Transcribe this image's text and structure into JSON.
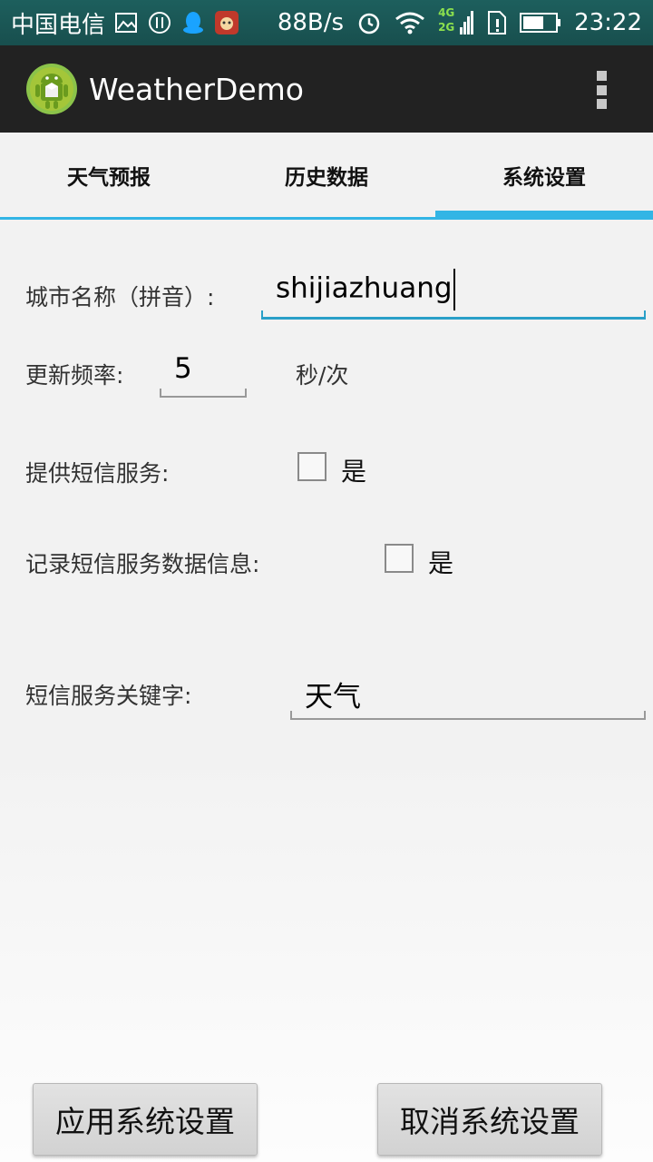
{
  "status_bar": {
    "carrier": "中国电信",
    "net_speed": "88B/s",
    "network_top": "4G",
    "network_bottom": "2G",
    "time": "23:22"
  },
  "action_bar": {
    "title": "WeatherDemo"
  },
  "tabs": [
    {
      "label": "天气预报",
      "active": false
    },
    {
      "label": "历史数据",
      "active": false
    },
    {
      "label": "系统设置",
      "active": true
    }
  ],
  "form": {
    "city_label": "城市名称（拼音）:",
    "city_value": "shijiazhuang",
    "frequency_label": "更新频率:",
    "frequency_value": "5",
    "frequency_unit": "秒/次",
    "sms_service_label": "提供短信服务:",
    "sms_service_option": "是",
    "sms_record_label": "记录短信服务数据信息:",
    "sms_record_option": "是",
    "sms_keyword_label": "短信服务关键字:",
    "sms_keyword_value": "天气"
  },
  "buttons": {
    "apply": "应用系统设置",
    "cancel": "取消系统设置"
  },
  "colors": {
    "accent": "#33b5e5",
    "status_bar": "#1d5f5d",
    "action_bar": "#222222"
  }
}
